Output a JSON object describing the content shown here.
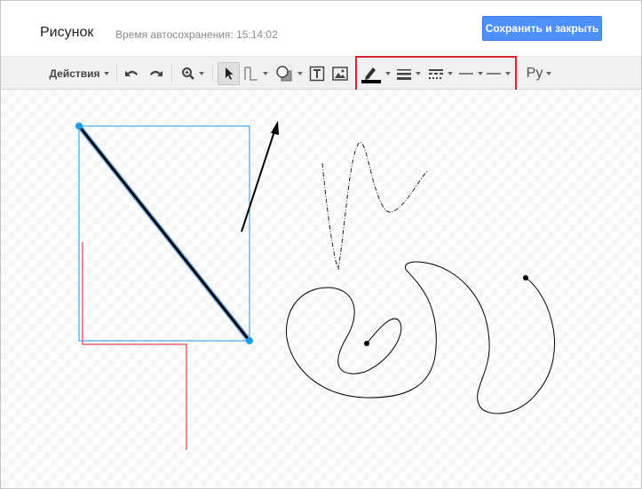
{
  "header": {
    "title": "Рисунок",
    "autosave": "Время автосохранения: 15:14:02",
    "save_button": "Сохранить и закрыть"
  },
  "toolbar": {
    "actions_label": "Действия",
    "input_tools_label": "Ру",
    "icons": [
      "undo-icon",
      "redo-icon",
      "zoom-icon",
      "select-icon",
      "line-icon",
      "shape-icon",
      "textbox-icon",
      "image-icon",
      "line-color-icon",
      "line-weight-icon",
      "line-dash-icon",
      "line-start-icon",
      "line-end-icon"
    ]
  },
  "colors": {
    "accent": "#4d90fe",
    "highlight_box": "#d9232a",
    "selection": "#1a9ee5",
    "red_line": "#e06666"
  }
}
